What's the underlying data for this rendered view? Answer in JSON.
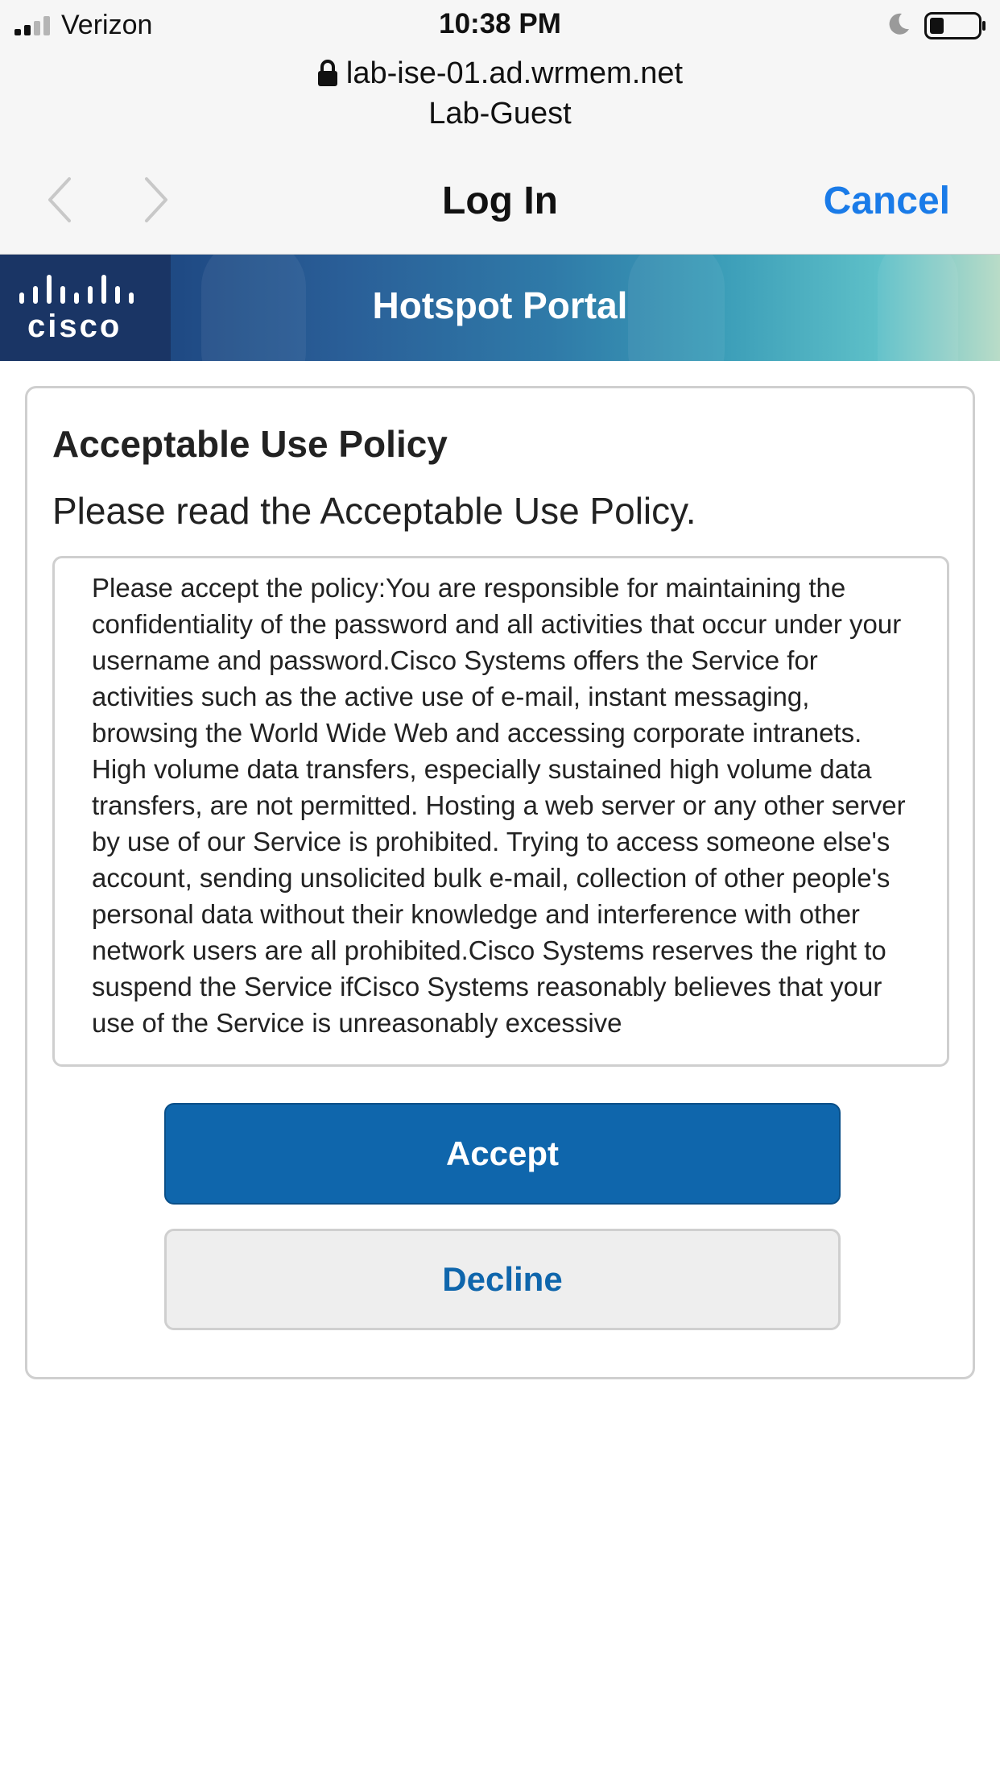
{
  "status_bar": {
    "carrier": "Verizon",
    "time": "10:38 PM",
    "signal_bars_active": 2,
    "signal_bars_total": 4,
    "battery_level": 0.3
  },
  "captive_header": {
    "url": "lab-ise-01.ad.wrmem.net",
    "network_name": "Lab-Guest",
    "nav_title": "Log In",
    "cancel_label": "Cancel"
  },
  "banner": {
    "brand": "cisco",
    "title": "Hotspot Portal"
  },
  "policy": {
    "heading": "Acceptable Use Policy",
    "subheading": "Please read the Acceptable Use Policy.",
    "body_text": "Please accept the policy:You are responsible for maintaining the confidentiality of the password and all activities that occur under your username and password.Cisco Systems offers the Service for activities such as the active use of e-mail, instant messaging, browsing the World Wide Web and accessing corporate intranets. High volume data transfers, especially sustained high volume data transfers, are not permitted. Hosting a web server or any other server by use of our Service is prohibited. Trying to access someone else's account, sending unsolicited bulk e-mail, collection of other people's personal data without their knowledge and interference with other network users are all prohibited.Cisco Systems reserves the right to suspend the Service ifCisco Systems reasonably believes that your use of the Service is unreasonably excessive"
  },
  "actions": {
    "accept_label": "Accept",
    "decline_label": "Decline"
  },
  "colors": {
    "ios_blue": "#1a7be8",
    "accept_blue": "#0f66ac",
    "banner_dark": "#1a3565",
    "banner_light": "#5ec0c8"
  },
  "icons": {
    "signal": "cellular-signal-icon",
    "moon": "do-not-disturb-moon-icon",
    "battery": "battery-icon",
    "lock": "lock-icon",
    "back": "chevron-left-icon",
    "forward": "chevron-right-icon",
    "logo": "cisco-logo"
  }
}
